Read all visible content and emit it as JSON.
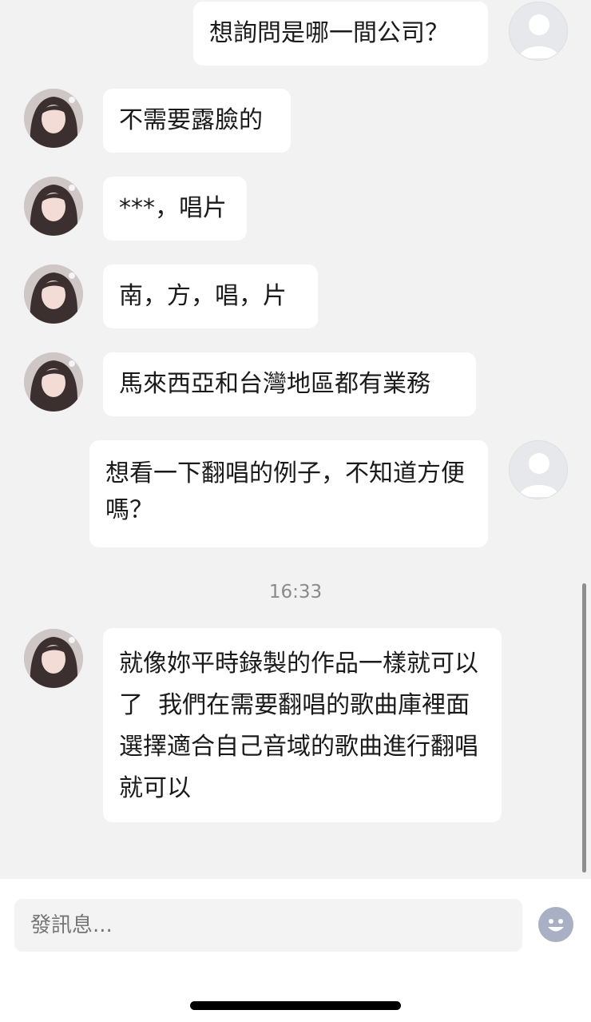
{
  "messages": [
    {
      "sender": "self",
      "text": "想詢問是哪一間公司？"
    },
    {
      "sender": "other",
      "text": "不需要露臉的"
    },
    {
      "sender": "other",
      "text": "***，唱片"
    },
    {
      "sender": "other",
      "text": "南，方，唱，片"
    },
    {
      "sender": "other",
      "text": "馬來西亞和台灣地區都有業務"
    },
    {
      "sender": "self",
      "text": "想看一下翻唱的例子，不知道方便嗎？"
    },
    {
      "sender": "other",
      "text": "就像妳平時錄製的作品一樣就可以了  我們在需要翻唱的歌曲庫裡面選擇適合自己音域的歌曲進行翻唱就可以"
    }
  ],
  "timestamp": "16:33",
  "composer": {
    "placeholder": "發訊息...",
    "emoji_icon": "smiley-face-icon"
  },
  "colors": {
    "background": "#f2f2f2",
    "bubble": "#ffffff",
    "text": "#1a1a1a",
    "timestamp": "#8a8a8a"
  }
}
